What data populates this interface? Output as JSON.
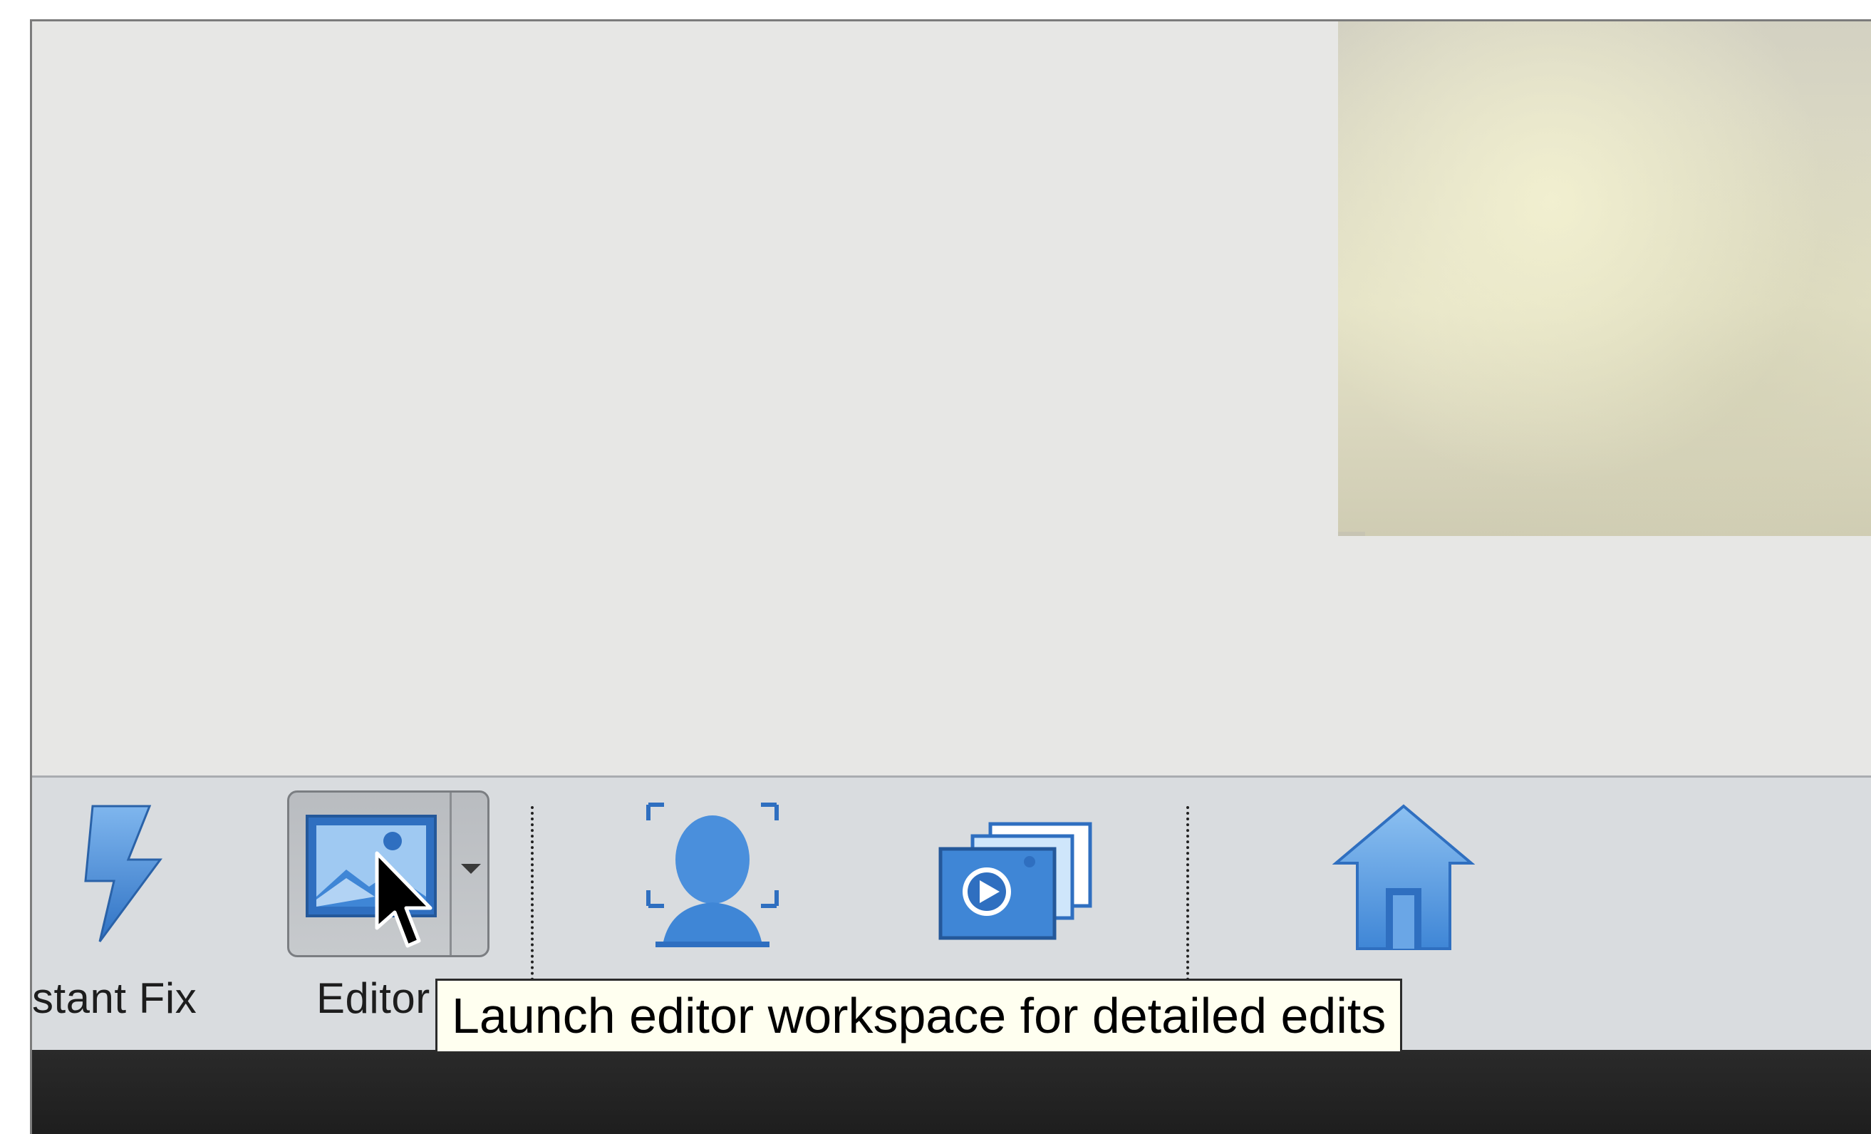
{
  "toolbar": {
    "items": [
      {
        "id": "instant-fix",
        "label": "stant Fix",
        "icon": "lightning-bolt-icon"
      },
      {
        "id": "editor",
        "label": "Editor",
        "icon": "photo-editor-icon",
        "has_dropdown": true
      },
      {
        "id": "mark-faces",
        "label": "",
        "icon": "face-portrait-icon"
      },
      {
        "id": "slideshow",
        "label": "",
        "icon": "slideshow-icon"
      },
      {
        "id": "home-screen",
        "label": "",
        "icon": "home-icon"
      }
    ]
  },
  "tooltip": {
    "text": "Launch editor workspace for detailed edits"
  },
  "colors": {
    "toolbar_bg": "#d9dcdf",
    "canvas_bg": "#e7e7e5",
    "icon_blue": "#3f86d6",
    "dock_bg": "#222222",
    "tooltip_bg": "#fffff0"
  }
}
